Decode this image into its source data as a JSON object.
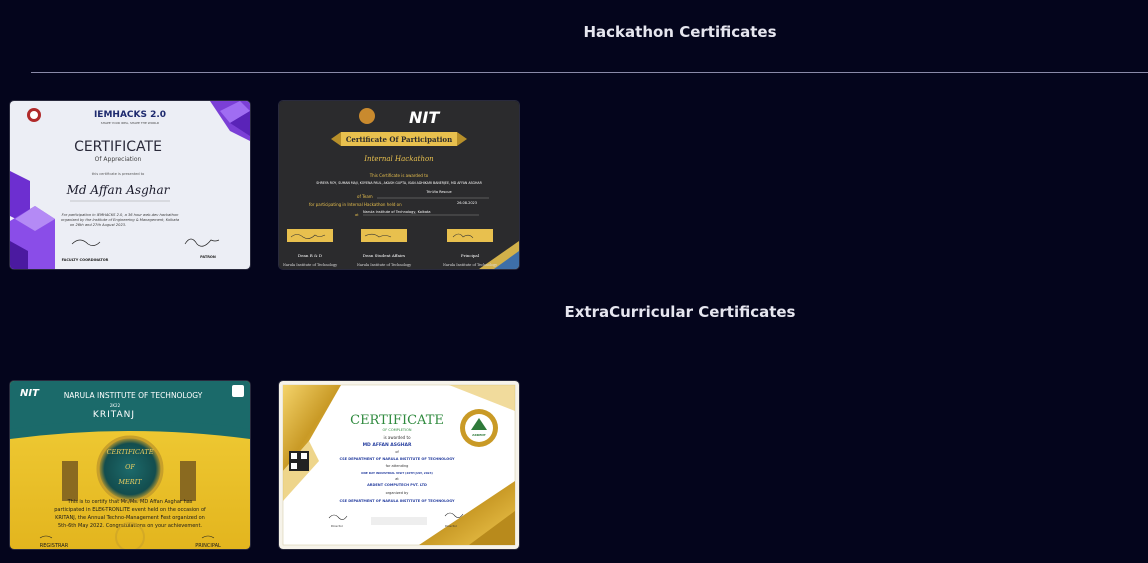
{
  "sections": {
    "hackathon_title": "Hackathon Certificates",
    "extracurricular_title": "ExtraCurricular Certificates"
  },
  "certs": {
    "iemhacks": {
      "brand": "IEMHACKS 2.0",
      "tagline": "SHAPE YOUR IDEA, SHAPE THE WORLD",
      "title": "CERTIFICATE",
      "subtitle": "Of Appreciation",
      "presented": "this certificate is presented to",
      "name": "Md Affan Asghar",
      "body1": "For participation in IEMHACKS 2.0, a 36 hour web-dev hackathon",
      "body2": "organized by the Institute of Engineering & Management, Kolkata",
      "body3": "on 26th and 27th August 2023.",
      "sig_left_role": "FACULTY COORDINATOR",
      "sig_right_role": "PATRON"
    },
    "nit_hackathon": {
      "logo": "NIT",
      "title": "Certificate Of Participation",
      "event": "Internal Hackathon",
      "awarded": "This Certificate is awarded to",
      "names": "SHREYA ROY, SUMAN MAJI, KOYENA PAUL, AKASH GUPTA, ISAN ADHIKARI BANERJEE, MD AFFAN ASGHAR",
      "team_label": "of Team",
      "team": "TrinVia Rescue",
      "participation": "for participating in Internal Hackathon held on",
      "date": "26.08.2023",
      "at_label": "at",
      "institute": "Narula Institute of Technology, Kolkata",
      "sig1_role": "Dean R & D",
      "sig2_role": "Dean Student Affairs",
      "sig3_role": "Principal",
      "footer": "Narula Institute of Technology"
    },
    "kritanj": {
      "logo": "NIT",
      "institute": "NARULA INSTITUTE OF TECHNOLOGY",
      "year": "2K22",
      "fest": "KRITANJ",
      "medal1": "CERTIFICATE",
      "medal2": "OF",
      "medal3": "MERIT",
      "body1": "This is to certify that Mr./Ms. MD Affan Asghar has",
      "body2": "participated in ELEK-TRONLITE event held on the occasion of",
      "body3": "KRITANJ, the Annual Techno-Management Fest organized on",
      "body4": "5th-6th May 2022. Congratulations on your achievement.",
      "sig_left": "REGISTRAR",
      "sig_right": "PRINCIPAL"
    },
    "completion": {
      "title": "CERTIFICATE",
      "subtitle": "OF COMPLETION",
      "awarded": "is awarded to",
      "name": "MD AFFAN ASGHAR",
      "of": "of",
      "dept": "CSE DEPARTMENT OF NARULA INSTITUTE OF TECHNOLOGY",
      "attending": "for attending",
      "visit": "ONE DAY INDUSTRIAL VISIT (20TH JULY, 2023)",
      "at": "at",
      "company": "ARDENT COMPUTECH PVT. LTD",
      "organized": "organized by",
      "organizer": "CSE DEPARTMENT OF NARULA INSTITUTE OF TECHNOLOGY",
      "sig_left": "Director",
      "sig_right": "Director",
      "badge": "ARDENT"
    }
  }
}
